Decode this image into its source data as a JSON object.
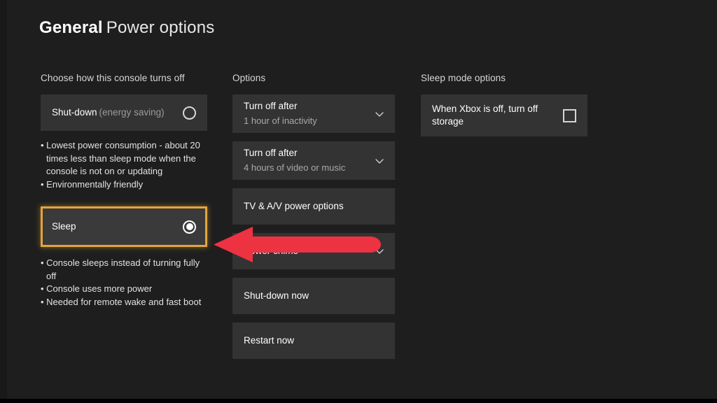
{
  "header": {
    "title_bold": "General",
    "title_rest": "Power options"
  },
  "colors": {
    "background": "#1e1e1e",
    "tile": "#333333",
    "focus_border": "#e3a53c",
    "annotation_red": "#ed3242",
    "text_primary": "#ffffff",
    "text_secondary": "#a9a9a9"
  },
  "left_column": {
    "heading": "Choose how this console turns off",
    "shutdown": {
      "label": "Shut-down",
      "suffix": "(energy saving)",
      "selected": false,
      "radio_icon": "radio-unselected-icon",
      "bullets": [
        "Lowest power consumption - about 20 times less than sleep mode when the console is not on or updating",
        "Environmentally friendly"
      ]
    },
    "sleep": {
      "label": "Sleep",
      "selected": true,
      "focused": true,
      "radio_icon": "radio-selected-icon",
      "bullets": [
        "Console sleeps instead of turning fully off",
        "Console uses more power",
        "Needed for remote wake and fast boot"
      ]
    }
  },
  "middle_column": {
    "heading": "Options",
    "items": [
      {
        "title": "Turn off after",
        "value": "1 hour of inactivity",
        "icon": "chevron-down-icon",
        "type": "dropdown"
      },
      {
        "title": "Turn off after",
        "value": "4 hours of video or music",
        "icon": "chevron-down-icon",
        "type": "dropdown"
      },
      {
        "title": "TV & A/V power options",
        "value": "",
        "icon": "",
        "type": "link"
      },
      {
        "title": "Power chime",
        "value": "",
        "icon": "chevron-down-icon",
        "type": "dropdown"
      },
      {
        "title": "Shut-down now",
        "value": "",
        "icon": "",
        "type": "button"
      },
      {
        "title": "Restart now",
        "value": "",
        "icon": "",
        "type": "button"
      }
    ]
  },
  "right_column": {
    "heading": "Sleep mode options",
    "storage_toggle": {
      "label": "When Xbox is off, turn off storage",
      "checked": false,
      "icon": "checkbox-unchecked-icon"
    }
  },
  "annotation": {
    "arrow_icon": "left-arrow-annotation",
    "points_to": "Sleep"
  }
}
